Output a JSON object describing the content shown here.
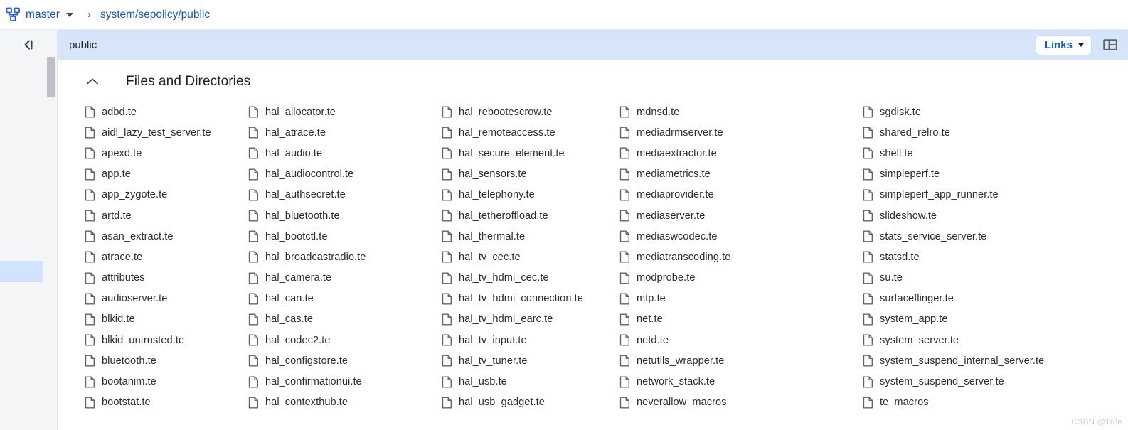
{
  "topbar": {
    "branch_icon": "git-branch-icon",
    "branch_name": "master",
    "branch_caret_icon": "chevron-down-icon",
    "separator": "›",
    "path": "system/sepolicy/public"
  },
  "left_rail": {
    "collapse_icon": "collapse-panel-icon",
    "scrollbar_name": "rail-scrollbar"
  },
  "panel": {
    "title": "public",
    "links_label": "Links",
    "links_caret_icon": "chevron-down-icon",
    "layout_toggle_icon": "panel-layout-icon"
  },
  "section": {
    "collapse_icon": "chevron-up-icon",
    "title": "Files and Directories"
  },
  "colors": {
    "link_blue": "#1a56c4",
    "panel_header_bg": "#d7e5fb",
    "rail_bg": "#f4f5f7",
    "rail_selected": "#d2e3fc",
    "text": "#2a2d33",
    "icon_stroke": "#5f6368",
    "watermark": "#c9ccd1"
  },
  "watermark": "CSDN @Tr0e",
  "columns": [
    [
      "adbd.te",
      "aidl_lazy_test_server.te",
      "apexd.te",
      "app.te",
      "app_zygote.te",
      "artd.te",
      "asan_extract.te",
      "atrace.te",
      "attributes",
      "audioserver.te",
      "blkid.te",
      "blkid_untrusted.te",
      "bluetooth.te",
      "bootanim.te",
      "bootstat.te"
    ],
    [
      "hal_allocator.te",
      "hal_atrace.te",
      "hal_audio.te",
      "hal_audiocontrol.te",
      "hal_authsecret.te",
      "hal_bluetooth.te",
      "hal_bootctl.te",
      "hal_broadcastradio.te",
      "hal_camera.te",
      "hal_can.te",
      "hal_cas.te",
      "hal_codec2.te",
      "hal_configstore.te",
      "hal_confirmationui.te",
      "hal_contexthub.te"
    ],
    [
      "hal_rebootescrow.te",
      "hal_remoteaccess.te",
      "hal_secure_element.te",
      "hal_sensors.te",
      "hal_telephony.te",
      "hal_tetheroffload.te",
      "hal_thermal.te",
      "hal_tv_cec.te",
      "hal_tv_hdmi_cec.te",
      "hal_tv_hdmi_connection.te",
      "hal_tv_hdmi_earc.te",
      "hal_tv_input.te",
      "hal_tv_tuner.te",
      "hal_usb.te",
      "hal_usb_gadget.te"
    ],
    [
      "mdnsd.te",
      "mediadrmserver.te",
      "mediaextractor.te",
      "mediametrics.te",
      "mediaprovider.te",
      "mediaserver.te",
      "mediaswcodec.te",
      "mediatranscoding.te",
      "modprobe.te",
      "mtp.te",
      "net.te",
      "netd.te",
      "netutils_wrapper.te",
      "network_stack.te",
      "neverallow_macros"
    ],
    [
      "sgdisk.te",
      "shared_relro.te",
      "shell.te",
      "simpleperf.te",
      "simpleperf_app_runner.te",
      "slideshow.te",
      "stats_service_server.te",
      "statsd.te",
      "su.te",
      "surfaceflinger.te",
      "system_app.te",
      "system_server.te",
      "system_suspend_internal_server.te",
      "system_suspend_server.te",
      "te_macros"
    ]
  ]
}
